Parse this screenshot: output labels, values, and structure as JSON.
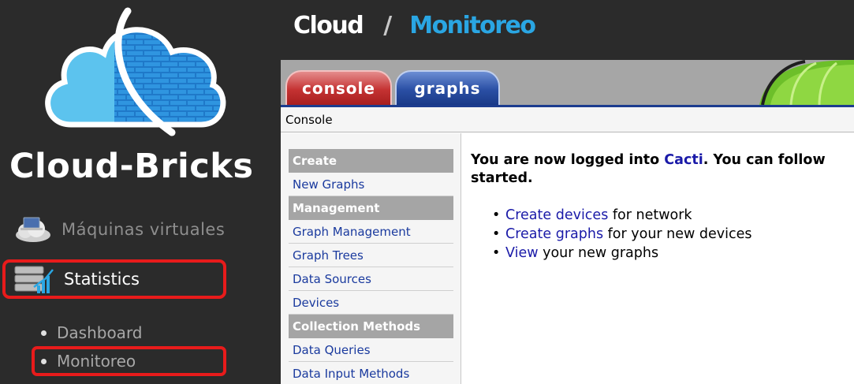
{
  "sidebar": {
    "brand": "Cloud-Bricks",
    "nav": [
      {
        "label": "Máquinas virtuales",
        "icon": "cloud-laptop-icon"
      },
      {
        "label": "Statistics",
        "icon": "server-chart-icon",
        "highlighted": true
      }
    ],
    "subnav": [
      {
        "label": "Dashboard"
      },
      {
        "label": "Monitoreo",
        "highlighted": true
      }
    ]
  },
  "header": {
    "crumb_root": "Cloud",
    "separator": "/",
    "crumb_current": "Monitoreo"
  },
  "cacti": {
    "tabs": [
      {
        "label": "console",
        "active": true
      },
      {
        "label": "graphs",
        "active": false
      }
    ],
    "breadcrumb": "Console",
    "menu": {
      "sections": [
        {
          "header": "Create",
          "items": [
            "New Graphs"
          ]
        },
        {
          "header": "Management",
          "items": [
            "Graph Management",
            "Graph Trees",
            "Data Sources",
            "Devices"
          ]
        },
        {
          "header": "Collection Methods",
          "items": [
            "Data Queries",
            "Data Input Methods"
          ]
        }
      ]
    },
    "main": {
      "msg_prefix": "You are now logged into ",
      "msg_link": "Cacti",
      "msg_suffix": ". You can follow",
      "msg_line2": "started.",
      "bullets": [
        {
          "link": "Create devices",
          "text": " for network"
        },
        {
          "link": "Create graphs",
          "text": " for your new devices"
        },
        {
          "link": "View",
          "text": " your new graphs"
        }
      ]
    }
  },
  "colors": {
    "sidebar_bg": "#2b2b2b",
    "accent_blue": "#2aa6e3",
    "highlight_red": "#e81b1b",
    "link_blue": "#1a1aa8"
  }
}
